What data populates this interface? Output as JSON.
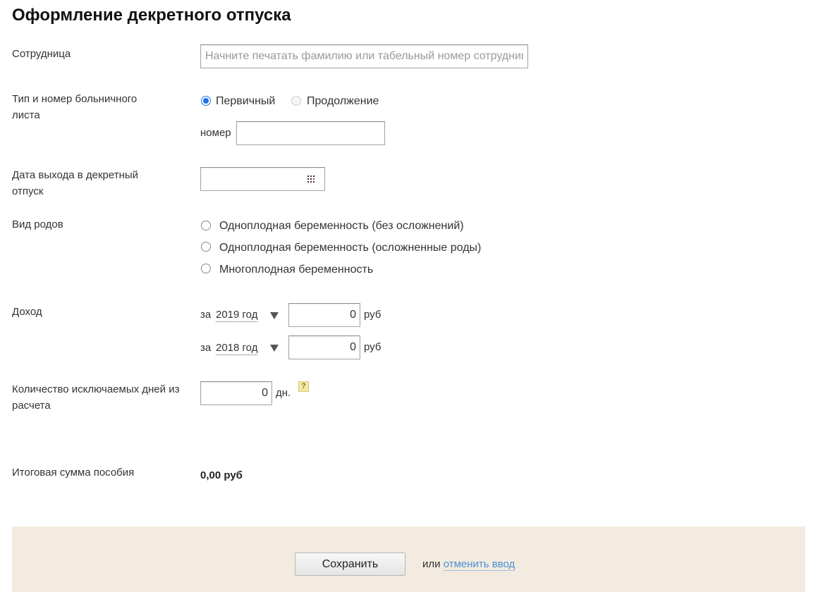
{
  "page": {
    "title": "Оформление декретного отпуска"
  },
  "employee": {
    "label": "Сотрудница",
    "placeholder": "Начните печатать фамилию или табельный номер сотрудницы",
    "value": ""
  },
  "sick_leave": {
    "label": "Тип и номер больничного листа",
    "options": [
      {
        "label": "Первичный",
        "checked": true,
        "disabled": false
      },
      {
        "label": "Продолжение",
        "checked": false,
        "disabled": true
      }
    ],
    "number_label": "номер",
    "number_value": ""
  },
  "leave_date": {
    "label": "Дата выхода в декретный отпуск",
    "value": "",
    "icon": "calendar-icon"
  },
  "birth_type": {
    "label": "Вид родов",
    "options": [
      {
        "label": "Одноплодная беременность (без осложнений)",
        "checked": false
      },
      {
        "label": "Одноплодная беременность (осложненные роды)",
        "checked": false
      },
      {
        "label": "Многоплодная беременность",
        "checked": false
      }
    ]
  },
  "income": {
    "label": "Доход",
    "rows": [
      {
        "prefix": "за",
        "year": "2019 год",
        "value": "0",
        "unit": "руб"
      },
      {
        "prefix": "за",
        "year": "2018 год",
        "value": "0",
        "unit": "руб"
      }
    ]
  },
  "excluded_days": {
    "label": "Количество исключаемых дней из расчета",
    "value": "0",
    "unit": "дн.",
    "help": "?"
  },
  "total": {
    "label": "Итоговая сумма пособия",
    "value": "0,00 руб"
  },
  "footer": {
    "save_label": "Сохранить",
    "or_text": "или",
    "cancel_label": "отменить ввод"
  },
  "colors": {
    "accent": "#1a73e8",
    "link": "#4a8fd3",
    "footer_bg": "#f3ebe0"
  }
}
